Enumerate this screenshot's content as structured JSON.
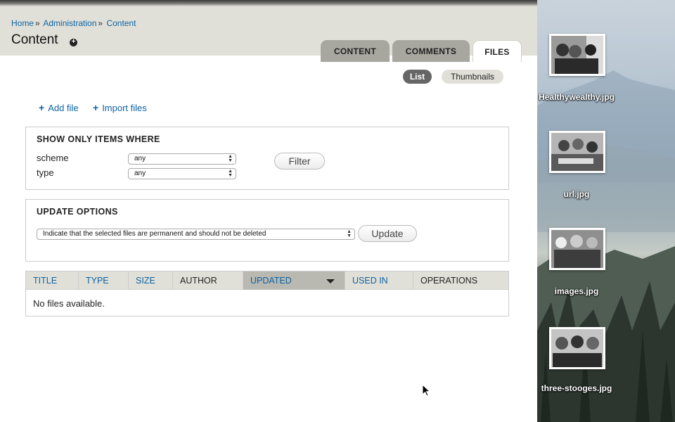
{
  "breadcrumb": {
    "items": [
      "Home",
      "Administration",
      "Content"
    ],
    "separator": "»"
  },
  "page": {
    "title": "Content",
    "shortcut_icon": "plus-circle-icon"
  },
  "tabs": [
    {
      "label": "CONTENT",
      "active": false
    },
    {
      "label": "COMMENTS",
      "active": false
    },
    {
      "label": "FILES",
      "active": true
    }
  ],
  "view_toggle": {
    "list": "List",
    "thumbnails": "Thumbnails",
    "selected": "List"
  },
  "actions": {
    "add_file": "Add file",
    "import_files": "Import files",
    "icon": "+"
  },
  "filter": {
    "legend": "SHOW ONLY ITEMS WHERE",
    "scheme_label": "scheme",
    "scheme_value": "any",
    "type_label": "type",
    "type_value": "any",
    "button": "Filter"
  },
  "update": {
    "legend": "UPDATE OPTIONS",
    "operation": "Indicate that the selected files are permanent and should not be deleted",
    "button": "Update"
  },
  "table": {
    "columns": [
      "TITLE",
      "TYPE",
      "SIZE",
      "AUTHOR",
      "UPDATED",
      "USED IN",
      "OPERATIONS"
    ],
    "sorted_column": "UPDATED",
    "sort_direction": "desc",
    "empty_message": "No files available."
  },
  "desktop": {
    "files": [
      {
        "name": "Healthywealthy.jpg"
      },
      {
        "name": "url.jpg"
      },
      {
        "name": "images.jpg"
      },
      {
        "name": "three-stooges.jpg"
      }
    ]
  },
  "colors": {
    "link": "#0b63a4",
    "header_bg": "#e1e0d8",
    "tab_inactive": "#a7a69f",
    "active_pill": "#666666"
  }
}
